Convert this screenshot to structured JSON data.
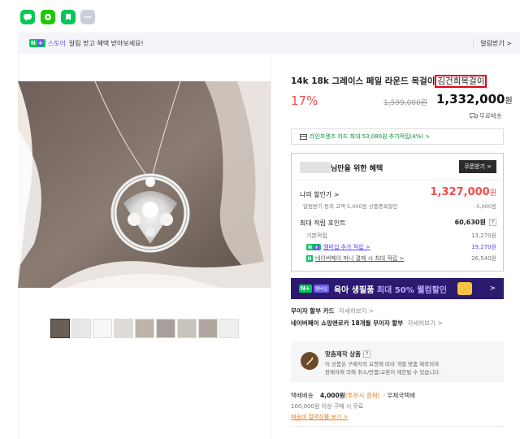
{
  "share": {
    "icons": [
      "line-icon",
      "band-icon",
      "bookmark-icon",
      "more-icon"
    ],
    "colors": [
      "#06c755",
      "#1ec800",
      "#03c75a",
      "#c9cfd8"
    ]
  },
  "banner": {
    "badge": "N",
    "badge_plus": "+",
    "store": "스토어",
    "text": "알림 받고 혜택 받아보세요!",
    "action": "알림받기 >"
  },
  "product": {
    "title_main": "14k 18k 그레이스 페일 라운드 목걸이",
    "title_highlight": "김건희목걸이",
    "discount": "17%",
    "original_price": "1,599,000원",
    "sale_price": "1,332,000",
    "won": "원",
    "shipping": "무료배송",
    "card_promo": "라인프렌즈 카드 최대 53,080원 추가적립(4%) >"
  },
  "benefit": {
    "header": "님만을 위한 혜택",
    "coupon_button": "쿠폰받기 >",
    "my_sale_label": "나의 할인가 >",
    "my_sale_price": "1,327,000",
    "won": "원",
    "alarm_text": "알림받기 동의 고객 5,000원 상품중복할인",
    "alarm_amount": "-5,000원",
    "points_label": "최대 적립 포인트",
    "points_total": "60,630원",
    "points_help": "?",
    "basic_label": "기본적립",
    "basic_amount": "13,270원",
    "membership_label": "멤버십 추가 적립 >",
    "membership_amount": "19,270원",
    "pay_label": "네이버페이 머니 결제 시 최대 적립 >",
    "pay_amount": "26,540원"
  },
  "ad": {
    "badge": "N+",
    "badge_small": "멤버십",
    "text": "육아 생필품 ",
    "highlight": "최대 50% 웰컴할인",
    "arrow": ">",
    "bg": "#2b1a6e"
  },
  "installment": {
    "label": "무이자 할부 카드",
    "link": "자세히보기 >",
    "npay_text": "네이버페이 쇼핑앤로카 18개월 무이자 할부",
    "npay_link": "자세히보기 >"
  },
  "custom": {
    "title": "맞춤제작 상품",
    "help": "?",
    "line1": "이 상품은 구매자의 요청에 따라 개별 맞춤 제작되며",
    "line2": "판매자에 의해 취소/반품/교환이 제한될 수 있습니다."
  },
  "delivery": {
    "label": "택배배송",
    "price": "4,000원",
    "note": "(주문시 결제)",
    "courier": "· 우체국택배",
    "condition": "100,000원 이상 구매 시 무료",
    "saving_link": "배송비 절약상품 보기 >"
  }
}
